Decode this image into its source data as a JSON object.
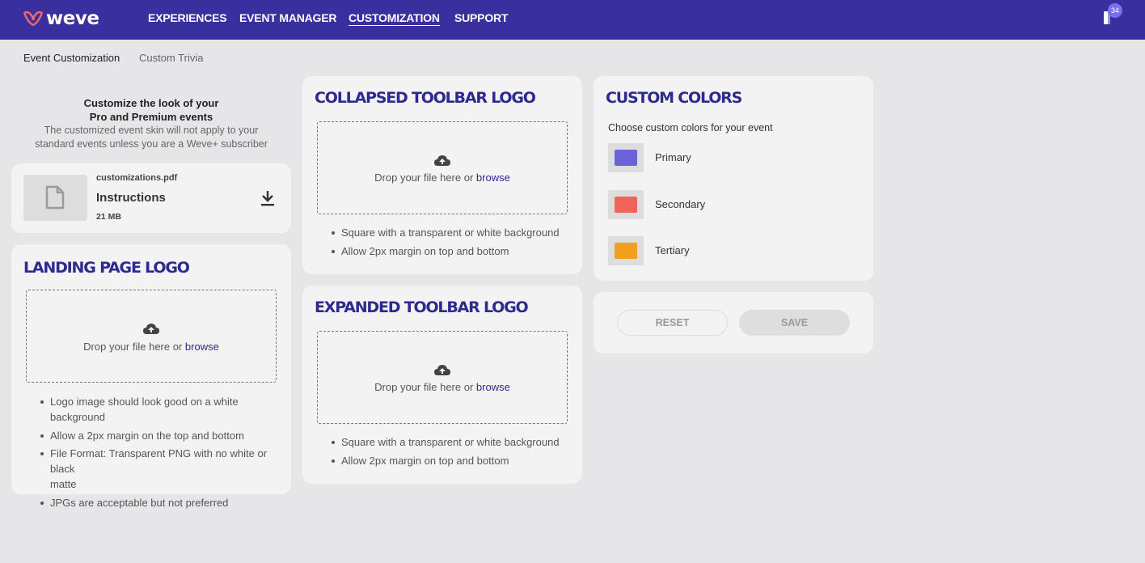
{
  "app": {
    "name": "weve"
  },
  "nav": {
    "items": [
      "EXPERIENCES",
      "EVENT MANAGER",
      "CUSTOMIZATION",
      "SUPPORT"
    ],
    "active": "CUSTOMIZATION",
    "notification_count": "34"
  },
  "subtabs": [
    "Event Customization",
    "Custom Trivia"
  ],
  "intro": {
    "heading_line1": "Customize the look of your",
    "heading_line2": "Pro and Premium events",
    "note_line1": "The customized event skin will not apply to your",
    "note_line2": "standard events unless you are a Weve+ subscriber"
  },
  "instructions_file": {
    "filename": "customizations.pdf",
    "title": "Instructions",
    "size": "21 MB"
  },
  "landing_logo": {
    "title": "LANDING PAGE LOGO",
    "drop_text": "Drop your file here or ",
    "browse": "browse",
    "bullets": [
      "Logo image should look good on a white background",
      "Allow a 2px margin on the top and bottom",
      "File Format: Transparent PNG with no white or black",
      "matte",
      "JPGs are acceptable but not preferred"
    ]
  },
  "collapsed_logo": {
    "title": "COLLAPSED TOOLBAR LOGO",
    "drop_text": "Drop your file here or ",
    "browse": "browse",
    "bullets": [
      "Square with a transparent or white background",
      "Allow 2px margin on top and bottom"
    ]
  },
  "expanded_logo": {
    "title": "EXPANDED TOOLBAR LOGO",
    "drop_text": "Drop your file here or ",
    "browse": "browse",
    "bullets": [
      "Square with a transparent or white background",
      "Allow 2px margin on top and bottom"
    ]
  },
  "custom_colors": {
    "title": "CUSTOM COLORS",
    "subtitle": "Choose custom colors for your event",
    "colors": [
      {
        "label": "Primary",
        "hex": "#6c63d6"
      },
      {
        "label": "Secondary",
        "hex": "#f0645a"
      },
      {
        "label": "Tertiary",
        "hex": "#f0a01e"
      }
    ]
  },
  "actions": {
    "reset": "RESET",
    "save": "SAVE"
  }
}
